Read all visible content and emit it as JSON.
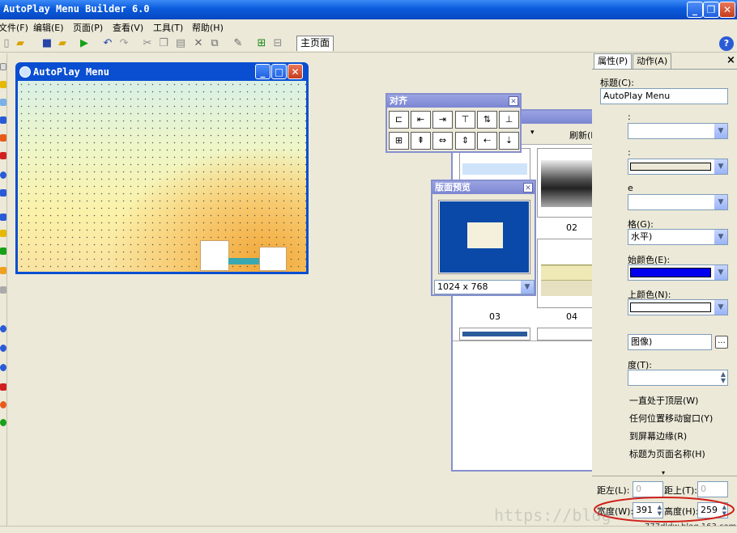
{
  "app": {
    "title": "AutoPlay Menu Builder 6.0",
    "colors": {
      "titlebar": "#0a5bdc",
      "palette_caption": "#7b86d1",
      "preview_blue": "#0a49a8",
      "annotation": "#d0201a"
    }
  },
  "menubar": {
    "items": [
      "文件(F)",
      "编辑(E)",
      "页面(P)",
      "查看(V)",
      "工具(T)",
      "帮助(H)"
    ]
  },
  "toolbar": {
    "icons": [
      "new-icon",
      "open-icon",
      "save-icon",
      "open-folder-icon",
      "play-icon",
      "undo-icon",
      "redo-icon",
      "cut-icon",
      "copy-icon",
      "paste-icon",
      "delete-icon",
      "duplicate-icon",
      "edit-icon",
      "add-page-icon",
      "remove-page-icon"
    ],
    "page_tab": "主页面"
  },
  "help_icon": "?",
  "design_window": {
    "title": "AutoPlay Menu"
  },
  "align_palette": {
    "title": "对齐",
    "buttons": [
      "align-left",
      "align-center-h",
      "align-right",
      "align-top",
      "align-middle",
      "align-bottom",
      "space-h",
      "space-v",
      "same-width",
      "same-height",
      "center-h",
      "center-v"
    ]
  },
  "template_panel": {
    "refresh_label": "刷新(R)",
    "thumb_labels": [
      "02",
      "03",
      "04"
    ]
  },
  "layout_preview": {
    "title": "版面预览",
    "resolution": "1024 x 768"
  },
  "props": {
    "tab_properties": "属性(P)",
    "tab_actions": "动作(A)",
    "close": "×",
    "title_label": "标题(C):",
    "title_value": "AutoPlay Menu",
    "label_2": ":",
    "label_3": ":",
    "label_4": "e",
    "style_label": "格(G):",
    "style_value": "水平)",
    "start_color_label": "始颜色(E):",
    "end_color_label": "上颜色(N):",
    "image_value": "图像)",
    "opacity_label": "度(T):",
    "ellipsis": "...",
    "chk_topmost": "一直处于顶层(W)",
    "chk_move": "任何位置移动窗口(Y)",
    "chk_snap": "到屏幕边缘(R)",
    "chk_titlepage": "标题为页面名称(H)",
    "left_label": "距左(L):",
    "left_value": "0",
    "top_label": "距上(T):",
    "top_value": "0",
    "width_label": "宽度(W):",
    "width_value": "391",
    "height_label": "高度(H):",
    "height_value": "259"
  },
  "watermark": "https://blog",
  "credit": "777dldw.blog.163.com"
}
